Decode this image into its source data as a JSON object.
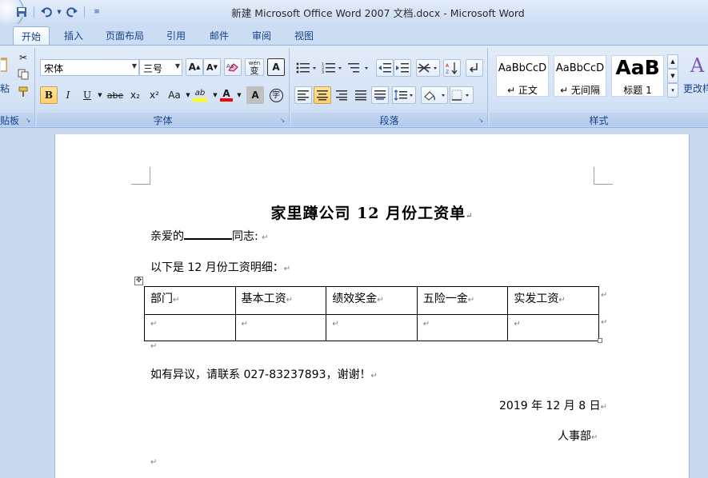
{
  "window": {
    "title": "新建 Microsoft Office Word 2007 文档.docx - Microsoft Word"
  },
  "tabs": [
    "开始",
    "插入",
    "页面布局",
    "引用",
    "邮件",
    "审阅",
    "视图"
  ],
  "ribbon": {
    "clipboard": {
      "paste_label": "粘",
      "group_label": "贴板"
    },
    "font": {
      "font_name": "宋体",
      "font_size": "三号",
      "grow_label": "A",
      "shrink_label": "A",
      "phonetic_label": "wén",
      "phonetic_char": "变",
      "border_char_label": "A",
      "bold_label": "B",
      "italic_label": "I",
      "underline_label": "U",
      "strike_label": "abe",
      "sub_label": "x₂",
      "sup_label": "x²",
      "case_label": "Aa",
      "highlight_label": "ab",
      "color_label": "A",
      "shade_label": "A",
      "enclose_label": "字",
      "group_label": "字体"
    },
    "paragraph": {
      "group_label": "段落"
    },
    "styles": {
      "items": [
        {
          "sample": "AaBbCcD",
          "name": "↵ 正文"
        },
        {
          "sample": "AaBbCcD",
          "name": "↵ 无间隔"
        },
        {
          "sample": "AaB",
          "name": "标题 1"
        }
      ],
      "change_label": "更改样",
      "group_label": "样式"
    },
    "colors": {
      "highlight": "#ffff00",
      "font_color": "#ff0000"
    }
  },
  "document": {
    "title": "家里蹲公司 12 月份工资单",
    "greeting_prefix": "亲爱的",
    "greeting_suffix": "同志:",
    "intro": "以下是 12 月份工资明细：",
    "table": {
      "headers": [
        "部门",
        "基本工资",
        "绩效奖金",
        "五险一金",
        "实发工资"
      ],
      "rows": [
        [
          "",
          "",
          "",
          "",
          ""
        ]
      ]
    },
    "contact": "如有异议，请联系 027-83237893，谢谢！",
    "date": "2019 年 12 月 8 日",
    "department": "人事部",
    "para_mark": "↵"
  }
}
